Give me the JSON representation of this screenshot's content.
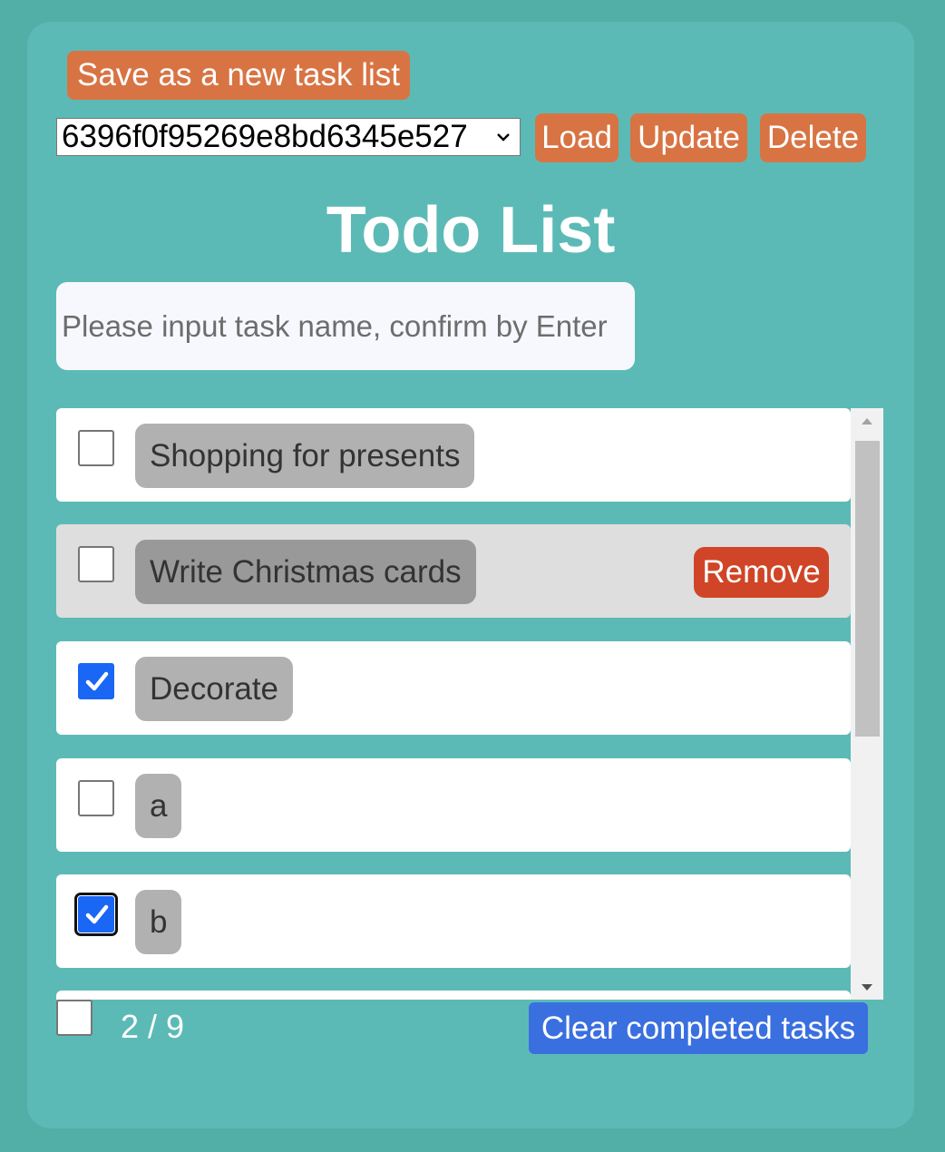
{
  "toolbar": {
    "save_new_label": "Save as a new task list",
    "list_selected": "6396f0f95269e8bd6345e527",
    "load_label": "Load",
    "update_label": "Update",
    "delete_label": "Delete"
  },
  "title": "Todo List",
  "task_input": {
    "placeholder": "Please input task name, confirm by Enter",
    "value": ""
  },
  "tasks": [
    {
      "name": "Shopping for presents",
      "done": false
    },
    {
      "name": "Write Christmas cards",
      "done": false,
      "remove_label": "Remove"
    },
    {
      "name": "Decorate",
      "done": true
    },
    {
      "name": "a",
      "done": false
    },
    {
      "name": "b",
      "done": true
    }
  ],
  "footer": {
    "select_all_checked": false,
    "count_text": "2 / 9",
    "clear_label": "Clear completed tasks"
  },
  "colors": {
    "background": "#52afa7",
    "panel": "#5cbab6",
    "orange_button": "#d87443",
    "remove_button": "#d04527",
    "clear_button": "#3a6fdf",
    "checkbox_checked": "#1a66f5"
  }
}
